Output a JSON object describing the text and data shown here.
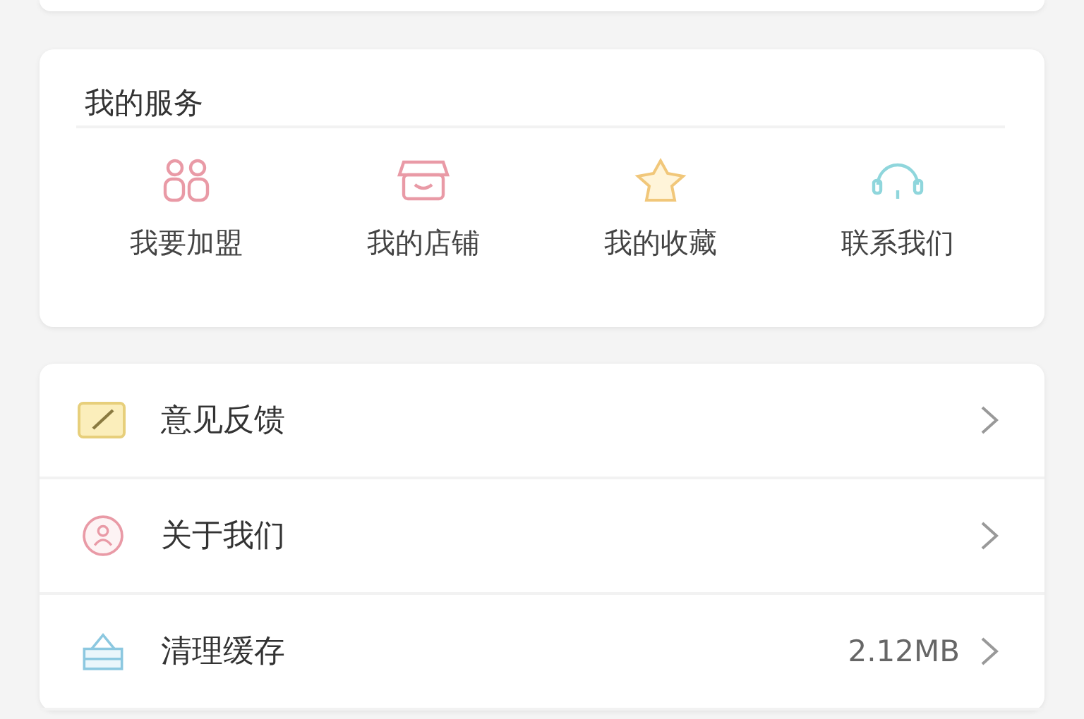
{
  "services": {
    "title": "我的服务",
    "items": [
      {
        "label": "我要加盟",
        "kind": "people"
      },
      {
        "label": "我的店铺",
        "kind": "shop"
      },
      {
        "label": "我的收藏",
        "kind": "star"
      },
      {
        "label": "联系我们",
        "kind": "headset"
      }
    ]
  },
  "menu": [
    {
      "label": "意见反馈",
      "kind": "feedback"
    },
    {
      "label": "关于我们",
      "kind": "about"
    },
    {
      "label": "清理缓存",
      "kind": "cache",
      "value": "2.12MB"
    }
  ]
}
